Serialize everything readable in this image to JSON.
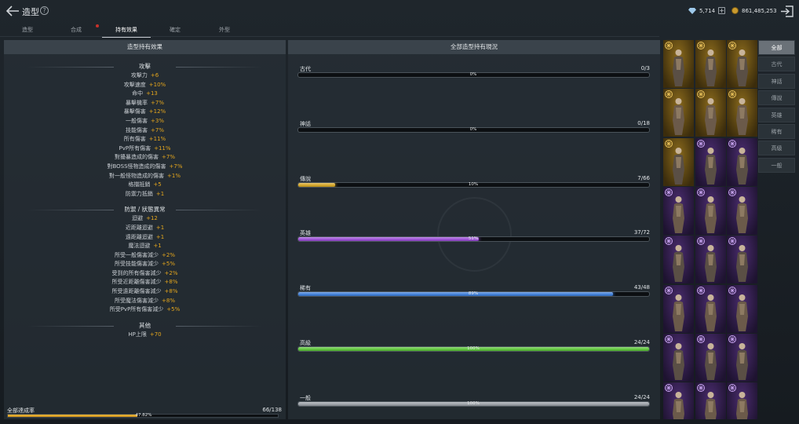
{
  "header": {
    "title": "造型",
    "gems": "5,714",
    "gold": "861,485,253"
  },
  "tabs": [
    {
      "label": "造型"
    },
    {
      "label": "合成"
    },
    {
      "label": "持有效果"
    },
    {
      "label": "確定"
    },
    {
      "label": "外型"
    }
  ],
  "left": {
    "heading": "造型持有效果",
    "sections": [
      {
        "title": "攻擊",
        "rows": [
          {
            "label": "攻擊力",
            "value": "+6"
          },
          {
            "label": "攻擊速度",
            "value": "+10%"
          },
          {
            "label": "命中",
            "value": "+13"
          },
          {
            "label": "暴擊機率",
            "value": "+7%"
          },
          {
            "label": "暴擊傷害",
            "value": "+12%"
          },
          {
            "label": "一般傷害",
            "value": "+3%"
          },
          {
            "label": "技能傷害",
            "value": "+7%"
          },
          {
            "label": "所有傷害",
            "value": "+11%"
          },
          {
            "label": "PvP所有傷害",
            "value": "+11%"
          },
          {
            "label": "對擾暴造成的傷害",
            "value": "+7%"
          },
          {
            "label": "對BOSS怪物造成的傷害",
            "value": "+7%"
          },
          {
            "label": "對一般怪物造成的傷害",
            "value": "+1%"
          },
          {
            "label": "格擋抵銷",
            "value": "+5"
          },
          {
            "label": "防禦力抵銷",
            "value": "+1"
          }
        ]
      },
      {
        "title": "防禦 / 狀態異常",
        "rows": [
          {
            "label": "迴避",
            "value": "+12"
          },
          {
            "label": "近距離迴避",
            "value": "+1"
          },
          {
            "label": "遠距離迴避",
            "value": "+1"
          },
          {
            "label": "魔法迴避",
            "value": "+1"
          },
          {
            "label": "所受一般傷害減少",
            "value": "+2%"
          },
          {
            "label": "所受技能傷害減少",
            "value": "+5%"
          },
          {
            "label": "受到的所有傷害減少",
            "value": "+2%"
          },
          {
            "label": "所受近距離傷害減少",
            "value": "+8%"
          },
          {
            "label": "所受遠距離傷害減少",
            "value": "+8%"
          },
          {
            "label": "所受魔法傷害減少",
            "value": "+8%"
          },
          {
            "label": "所受PvP所有傷害減少",
            "value": "+5%"
          }
        ]
      },
      {
        "title": "其他",
        "rows": [
          {
            "label": "HP上限",
            "value": "+70"
          }
        ]
      }
    ],
    "total": {
      "label": "全部達成率",
      "count": "66/138",
      "percent": "47.82%",
      "fraction": 0.4782
    }
  },
  "mid": {
    "heading": "全部造型持有現況",
    "rarities": [
      {
        "name": "古代",
        "count": "0/3",
        "pct": "0%",
        "fraction": 0,
        "color": "#c9a23a"
      },
      {
        "name": "神話",
        "count": "0/18",
        "pct": "0%",
        "fraction": 0,
        "color": "#c9a23a"
      },
      {
        "name": "傳說",
        "count": "7/66",
        "pct": "10%",
        "fraction": 0.106,
        "color": "#d4a526"
      },
      {
        "name": "英雄",
        "count": "37/72",
        "pct": "51%",
        "fraction": 0.514,
        "color": "#9b4fd6"
      },
      {
        "name": "稀有",
        "count": "43/48",
        "pct": "89%",
        "fraction": 0.896,
        "color": "#3f7fd8"
      },
      {
        "name": "高級",
        "count": "24/24",
        "pct": "100%",
        "fraction": 1,
        "color": "#5cc43a"
      },
      {
        "name": "一般",
        "count": "24/24",
        "pct": "100%",
        "fraction": 1,
        "color": "#9aa0a6"
      }
    ]
  },
  "costumes": {
    "rows": [
      [
        "gold",
        "gold",
        "gold"
      ],
      [
        "gold",
        "gold",
        "gold"
      ],
      [
        "gold",
        "purple",
        "purple"
      ],
      [
        "purple",
        "purple",
        "purple"
      ],
      [
        "purple",
        "purple",
        "purple"
      ],
      [
        "purple",
        "purple",
        "purple"
      ],
      [
        "purple",
        "purple",
        "purple"
      ],
      [
        "purple",
        "purple",
        "purple"
      ]
    ]
  },
  "filters": [
    {
      "label": "全部"
    },
    {
      "label": "古代"
    },
    {
      "label": "神話"
    },
    {
      "label": "傳說"
    },
    {
      "label": "英雄"
    },
    {
      "label": "稀有"
    },
    {
      "label": "高級"
    },
    {
      "label": "一般"
    }
  ]
}
